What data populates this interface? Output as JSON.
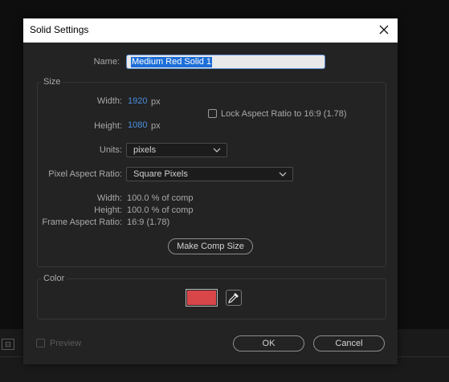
{
  "dialog": {
    "title": "Solid Settings"
  },
  "name": {
    "label": "Name:",
    "value": "Medium Red Solid 1"
  },
  "size": {
    "title": "Size",
    "width_label": "Width:",
    "width_value": "1920",
    "width_unit": "px",
    "height_label": "Height:",
    "height_value": "1080",
    "height_unit": "px",
    "lock_label": "Lock Aspect Ratio to 16:9 (1.78)",
    "units_label": "Units:",
    "units_value": "pixels",
    "par_label": "Pixel Aspect Ratio:",
    "par_value": "Square Pixels",
    "info": {
      "width_label": "Width:",
      "width_value": "100.0 % of comp",
      "height_label": "Height:",
      "height_value": "100.0 % of comp",
      "far_label": "Frame Aspect Ratio:",
      "far_value": "16:9 (1.78)"
    },
    "make_comp_size_label": "Make Comp Size"
  },
  "color": {
    "title": "Color",
    "swatch": "#d8464a"
  },
  "footer": {
    "preview_label": "Preview",
    "ok_label": "OK",
    "cancel_label": "Cancel"
  },
  "icons": {
    "close": "close-icon",
    "chevron": "chevron-down-icon",
    "eyedropper": "eyedropper-icon"
  }
}
